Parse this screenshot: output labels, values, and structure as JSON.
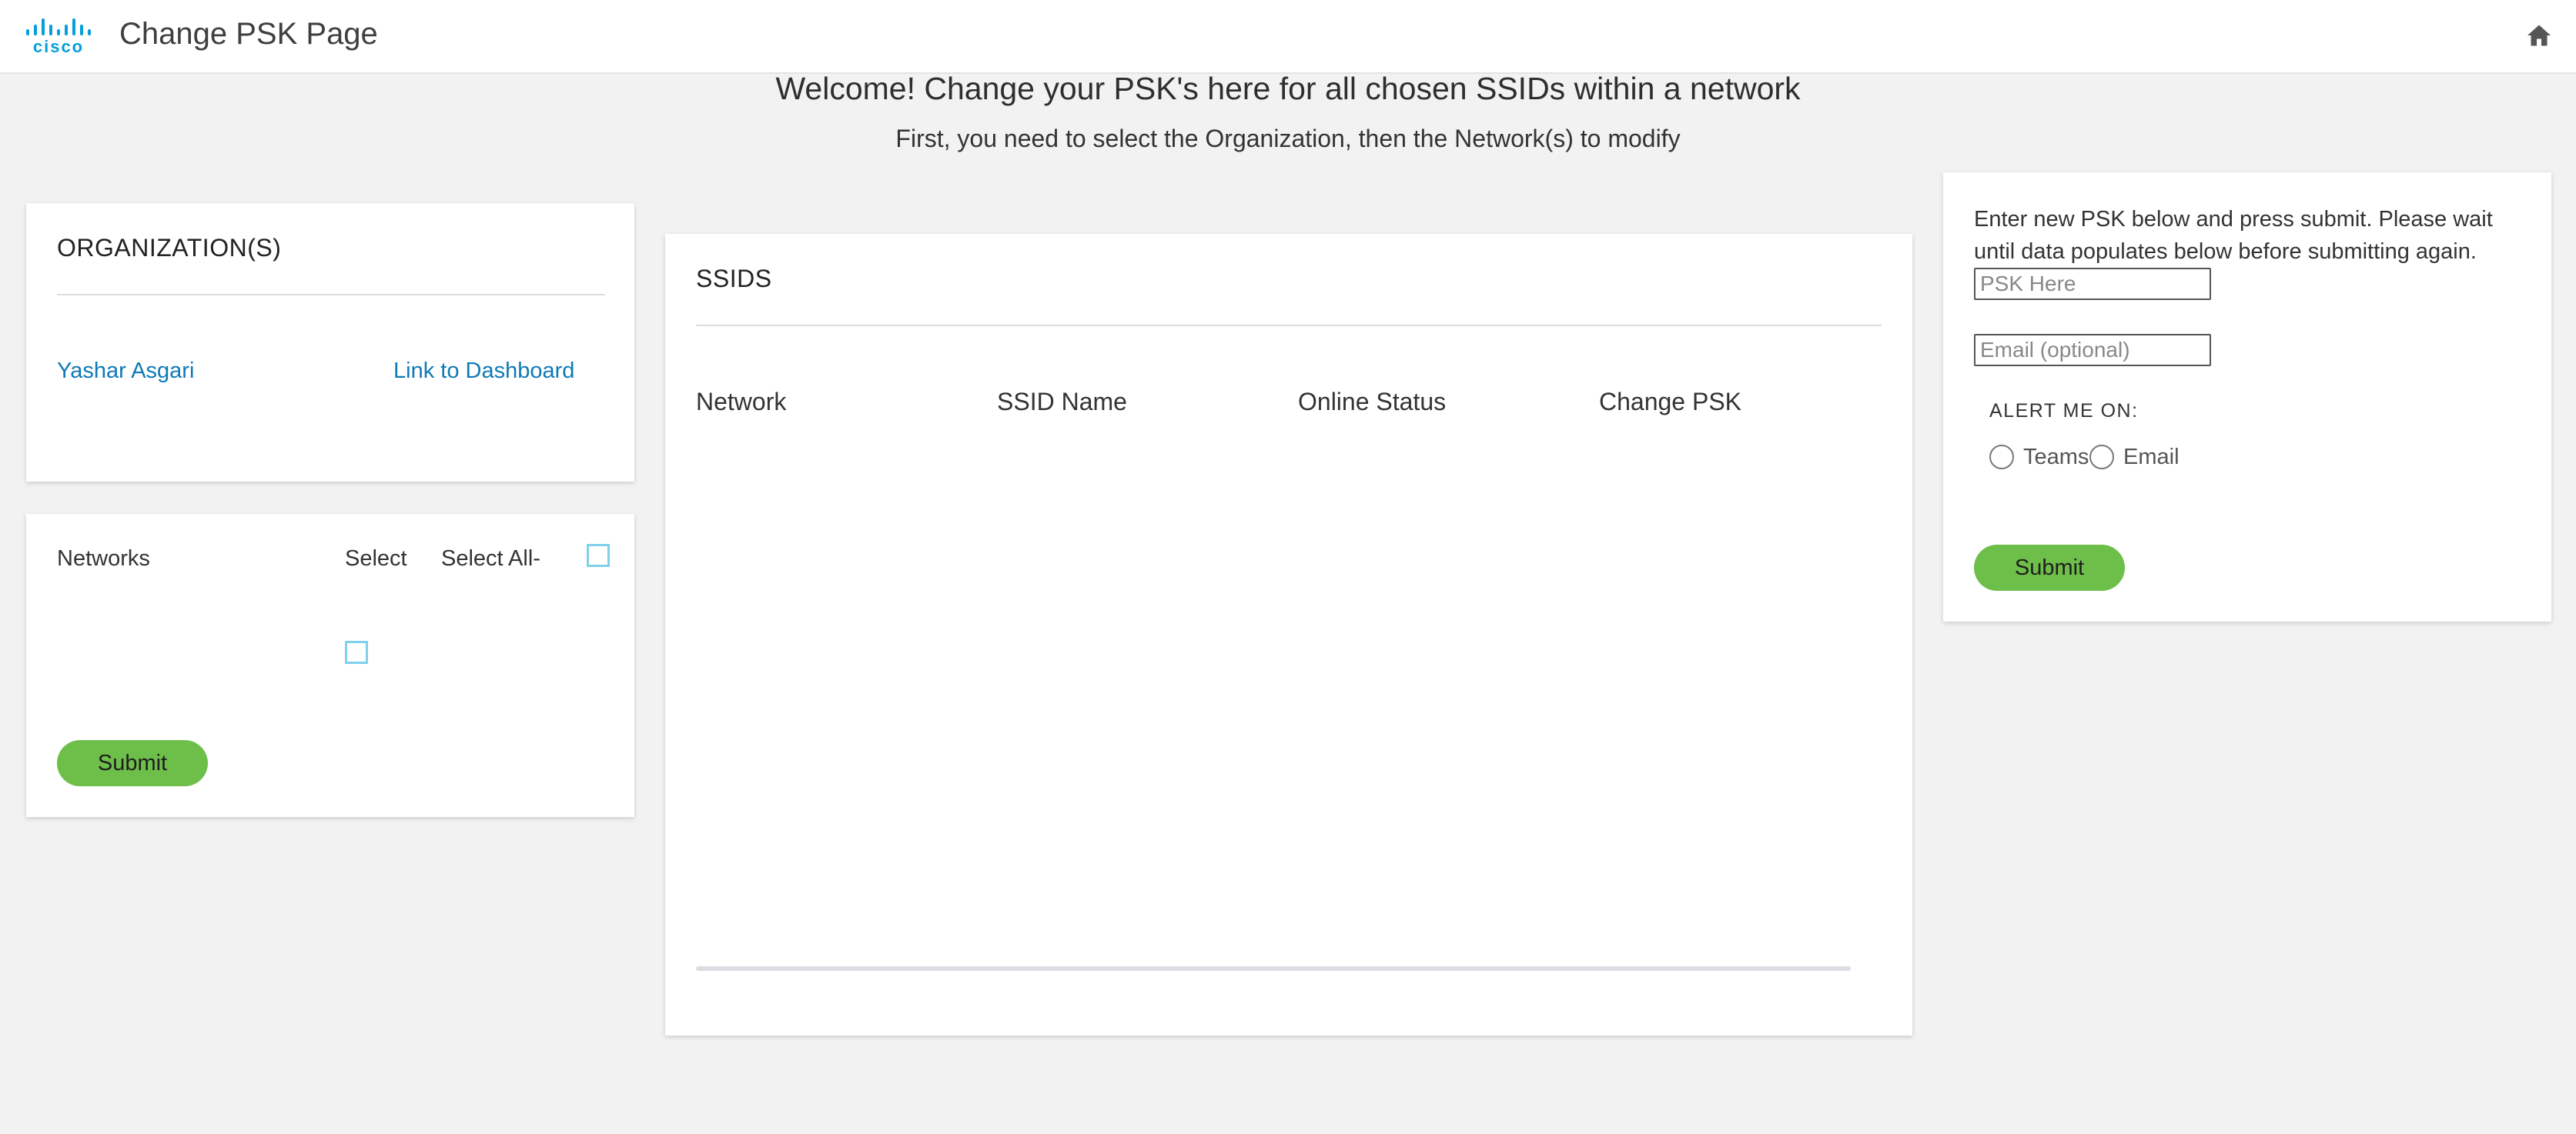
{
  "header": {
    "logo_text": "cisco",
    "title": "Change PSK Page",
    "home_icon": "home-icon"
  },
  "intro": {
    "welcome": "Welcome! Change your PSK's here for all chosen SSIDs within a network",
    "instructions": "First, you need to select the Organization, then the Network(s) to modify"
  },
  "organizations": {
    "title": "ORGANIZATION(S)",
    "items": [
      {
        "name": "Yashar Asgari",
        "dashboard_link": "Link to Dashboard"
      }
    ]
  },
  "networks": {
    "col_networks": "Networks",
    "col_select": "Select",
    "select_all_label": "Select All-",
    "submit_label": "Submit"
  },
  "ssids": {
    "title": "SSIDS",
    "columns": [
      "Network",
      "SSID Name",
      "Online Status",
      "Change PSK"
    ],
    "rows": []
  },
  "psk_form": {
    "instructions": "Enter new PSK below and press submit. Please wait until data populates below before submitting again.",
    "psk_placeholder": "PSK Here",
    "email_placeholder": "Email (optional)",
    "alert_label": "ALERT ME ON:",
    "options": [
      "Teams",
      "Email"
    ],
    "submit_label": "Submit"
  },
  "colors": {
    "background": "#f2f2f2",
    "brand": "#049fd9",
    "link": "#0e7ab5",
    "submit": "#6ebe4a"
  }
}
